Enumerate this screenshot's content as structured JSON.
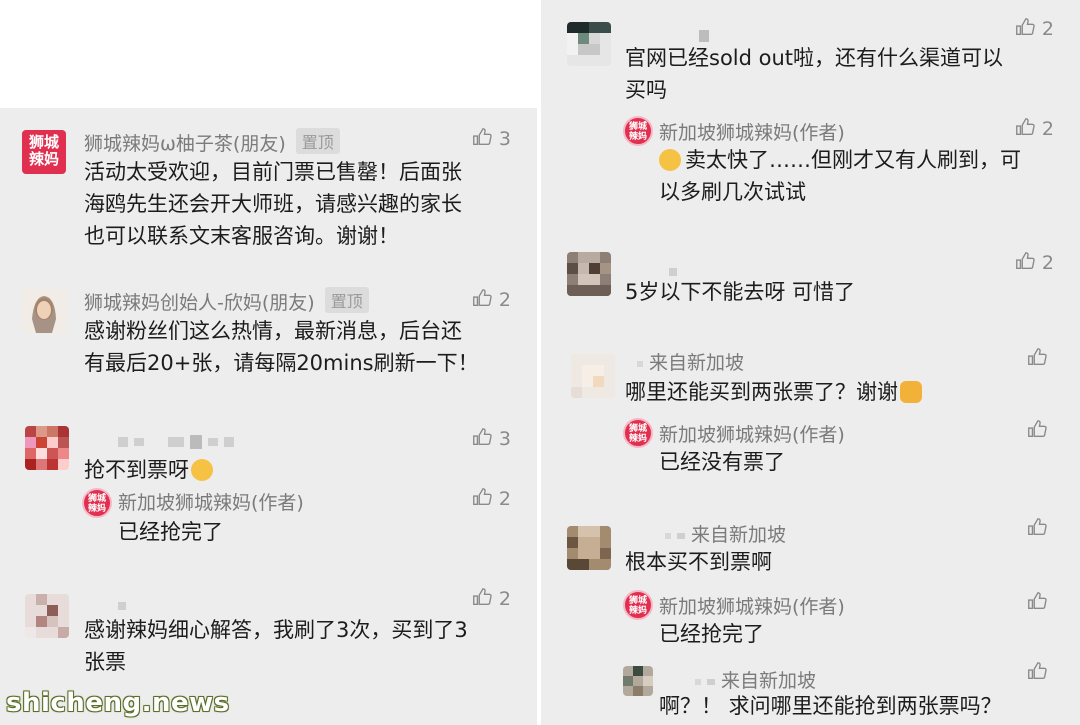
{
  "left": {
    "comments": [
      {
        "name": "狮城辣妈ω柚子茶(朋友)",
        "tag": "置顶",
        "text_lines": [
          "活动太受欢迎，目前门票已售罄！后面张",
          "海鸥先生还会开大师班，请感兴趣的家长",
          "也可以联系文末客服咨询。谢谢！"
        ],
        "likes": "3"
      },
      {
        "name": "狮城辣妈创始人-欣妈(朋友)",
        "tag": "置顶",
        "text_lines": [
          "感谢粉丝们这么热情，最新消息，后台还",
          "有最后20+张，请每隔20mins刷新一下！"
        ],
        "likes": "2"
      },
      {
        "text": "抢不到票呀",
        "likes": "3",
        "emoji": "grinning-sweat-emoji"
      },
      {
        "name": "新加坡狮城辣妈(作者)",
        "text": "已经抢完了",
        "likes": "2",
        "reply": true
      },
      {
        "text_lines": [
          "感谢辣妈细心解答，我刷了3次，买到了3",
          "张票"
        ],
        "likes": "2"
      }
    ]
  },
  "right": {
    "comments": [
      {
        "text_lines": [
          "官网已经sold out啦，还有什么渠道可以",
          "买吗"
        ],
        "likes": "2"
      },
      {
        "name": "新加坡狮城辣妈(作者)",
        "text_lines": [
          "卖太快了……但刚才又有人刷到，可",
          "以多刷几次试试"
        ],
        "likes": "2",
        "reply": true,
        "emoji": "sweat-emoji"
      },
      {
        "text": "5岁以下不能去呀 可惜了",
        "likes": "2"
      },
      {
        "location": "来自新加坡",
        "text": "哪里还能买到两张票了？谢谢",
        "emoji": "folded-hands-emoji"
      },
      {
        "name": "新加坡狮城辣妈(作者)",
        "text": "已经没有票了",
        "reply": true
      },
      {
        "location": "来自新加坡",
        "text": "根本买不到票啊"
      },
      {
        "name": "新加坡狮城辣妈(作者)",
        "text": "已经抢完了",
        "reply": true
      },
      {
        "location": "来自新加坡",
        "text": "啊？！ 求问哪里还能抢到两张票吗？",
        "reply": true
      }
    ]
  },
  "logo_text": "狮城辣妈",
  "watermark": "shicheng.news",
  "colors": {
    "panel_bg": "#ededed",
    "brand": "#e02f4f",
    "meta_gray": "#7b7b7b"
  }
}
